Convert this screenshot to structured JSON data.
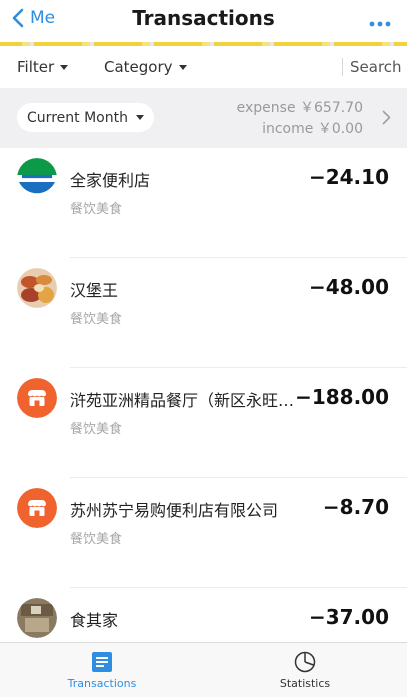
{
  "nav": {
    "back_label": "Me",
    "title": "Transactions",
    "more_icon": "more-dots-icon"
  },
  "filterbar": {
    "filter_label": "Filter",
    "category_label": "Category",
    "search_label": "Search"
  },
  "summary": {
    "month_label": "Current Month",
    "expense": "expense ￥657.70",
    "income": "income ￥0.00"
  },
  "transactions": [
    {
      "name": "全家便利店",
      "category": "餐饮美食",
      "amount": "−24.10",
      "icon": "familymart-logo"
    },
    {
      "name": "汉堡王",
      "category": "餐饮美食",
      "amount": "−48.00",
      "icon": "food-photo-avatar"
    },
    {
      "name": "浒苑亚洲精品餐厅（新区永旺…",
      "category": "餐饮美食",
      "amount": "−188.00",
      "icon": "shop-icon"
    },
    {
      "name": "苏州苏宁易购便利店有限公司",
      "category": "餐饮美食",
      "amount": "−8.70",
      "icon": "shop-icon"
    },
    {
      "name": "食其家",
      "category": "",
      "amount": "−37.00",
      "icon": "restaurant-photo-avatar"
    }
  ],
  "tabbar": {
    "tabs": [
      {
        "label": "Transactions",
        "icon": "list-icon",
        "active": true
      },
      {
        "label": "Statistics",
        "icon": "pie-chart-icon",
        "active": false
      }
    ]
  },
  "colors": {
    "accent": "#2f8ee0",
    "shop_orange": "#f0622e",
    "familymart_green": "#0d9a48",
    "familymart_blue": "#1a6fc0"
  }
}
